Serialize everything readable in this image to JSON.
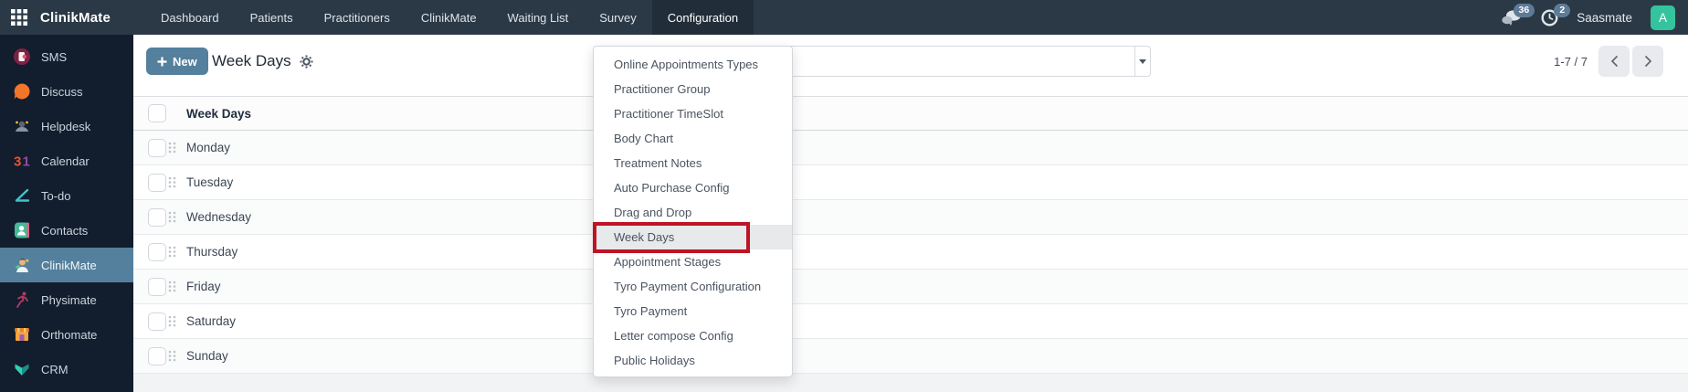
{
  "topbar": {
    "brand": "ClinikMate",
    "menu_items": [
      "Dashboard",
      "Patients",
      "Practitioners",
      "ClinikMate",
      "Waiting List",
      "Survey",
      "Configuration"
    ],
    "active_menu": "Configuration",
    "messages_badge": "36",
    "activity_badge": "2",
    "company": "Saasmate",
    "avatar_initial": "A"
  },
  "sidebar": {
    "items": [
      {
        "label": "SMS",
        "icon": "sms-icon"
      },
      {
        "label": "Discuss",
        "icon": "discuss-icon"
      },
      {
        "label": "Helpdesk",
        "icon": "helpdesk-icon"
      },
      {
        "label": "Calendar",
        "icon": "calendar-icon"
      },
      {
        "label": "To-do",
        "icon": "todo-icon"
      },
      {
        "label": "Contacts",
        "icon": "contacts-icon"
      },
      {
        "label": "ClinikMate",
        "icon": "clinikmate-icon",
        "active": true
      },
      {
        "label": "Physimate",
        "icon": "physimate-icon"
      },
      {
        "label": "Orthomate",
        "icon": "orthomate-icon"
      },
      {
        "label": "CRM",
        "icon": "crm-icon"
      }
    ]
  },
  "control_panel": {
    "new_button": "New",
    "title": "Week Days",
    "pager": "1-7 / 7"
  },
  "dropdown": {
    "items": [
      "Online Appointments Types",
      "Practitioner Group",
      "Practitioner TimeSlot",
      "Body Chart",
      "Treatment Notes",
      "Auto Purchase Config",
      "Drag and Drop",
      "Week Days",
      "Appointment Stages",
      "Tyro Payment Configuration",
      "Tyro Payment",
      "Letter compose Config",
      "Public Holidays"
    ],
    "highlighted_item": "Week Days"
  },
  "table": {
    "header": "Week Days",
    "rows": [
      "Monday",
      "Tuesday",
      "Wednesday",
      "Thursday",
      "Friday",
      "Saturday",
      "Sunday"
    ]
  },
  "colors": {
    "accent_blue": "#54809d",
    "topbar_bg": "#2b3946",
    "sidebar_bg": "#121d2e",
    "avatar_green": "#34c39c",
    "badge_blue": "#5d7b97",
    "highlight_red": "#c01325"
  }
}
